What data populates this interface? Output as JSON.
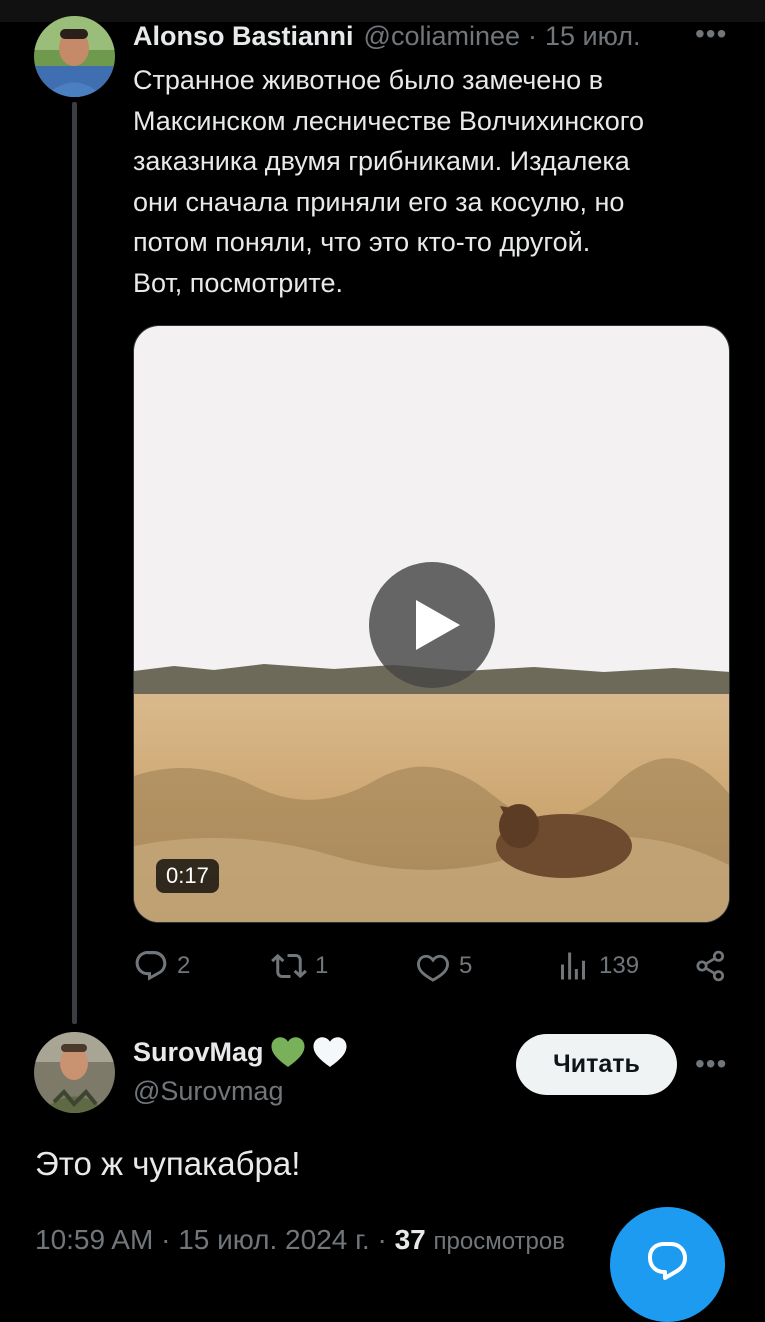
{
  "post": {
    "author_name": "Alonso Bastianni",
    "author_handle": "@coliaminee",
    "separator": "·",
    "date": "15 июл.",
    "more_icon": "more-horizontal-icon",
    "text_lines": [
      "Странное животное было замечено в",
      "Максинском лесничестве Волчихинского",
      "заказника двумя грибниками. Издалека",
      "они сначала приняли его за косулю, но",
      "потом поняли, что это кто-то другой.",
      "Вот, посмотрите."
    ],
    "video": {
      "duration": "0:17",
      "play_icon": "play-icon"
    },
    "actions": {
      "replies": "2",
      "reposts": "1",
      "likes": "5",
      "views": "139"
    }
  },
  "reply": {
    "author_name": "SurovMag",
    "author_handle": "@Surovmag",
    "name_emoji": [
      "green-heart-icon",
      "white-heart-icon"
    ],
    "follow_label": "Читать",
    "text": "Это ж чупакабра!",
    "time": "10:59 AM",
    "separator": "·",
    "date": "15 июл. 2024 г.",
    "views_count": "37",
    "views_label": "просмотров"
  },
  "colors": {
    "background": "#000000",
    "text_primary": "#e7e9ea",
    "text_secondary": "#71767b",
    "accent": "#1d9bf0",
    "follow_button_bg": "#eff3f4",
    "green_heart": "#78b159"
  }
}
